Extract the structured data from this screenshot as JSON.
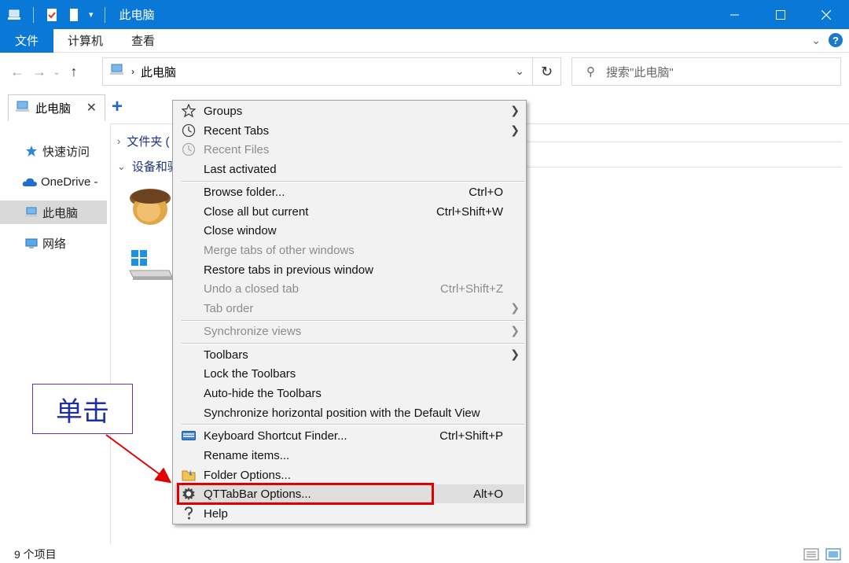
{
  "window": {
    "title": "此电脑"
  },
  "ribbon": {
    "tabs": [
      "文件",
      "计算机",
      "查看"
    ],
    "help": "?"
  },
  "address": {
    "crumb": "此电脑"
  },
  "search": {
    "placeholder": "搜索\"此电脑\""
  },
  "tabbar": {
    "tab_label": "此电脑",
    "close": "✕",
    "add": "+"
  },
  "navpane": {
    "items": [
      "快速访问",
      "OneDrive -",
      "此电脑",
      "网络"
    ]
  },
  "content": {
    "groups": [
      "文件夹 (",
      "设备和驱"
    ]
  },
  "status": {
    "count": "9 个项目"
  },
  "menu": {
    "items": [
      {
        "label": "Groups",
        "shortcut": "",
        "icon": "star-icon",
        "disabled": false,
        "submenu": true
      },
      {
        "label": "Recent Tabs",
        "shortcut": "",
        "icon": "clock-icon",
        "disabled": false,
        "submenu": true
      },
      {
        "label": "Recent Files",
        "shortcut": "",
        "icon": "clock-icon",
        "disabled": true,
        "submenu": false
      },
      {
        "label": "Last activated",
        "shortcut": "",
        "icon": "",
        "disabled": false,
        "submenu": false
      },
      {
        "label": "Browse folder...",
        "shortcut": "Ctrl+O",
        "icon": "",
        "disabled": false,
        "submenu": false
      },
      {
        "label": "Close all but current",
        "shortcut": "Ctrl+Shift+W",
        "icon": "",
        "disabled": false,
        "submenu": false
      },
      {
        "label": "Close window",
        "shortcut": "",
        "icon": "",
        "disabled": false,
        "submenu": false
      },
      {
        "label": "Merge tabs of other windows",
        "shortcut": "",
        "icon": "",
        "disabled": true,
        "submenu": false
      },
      {
        "label": "Restore tabs in previous window",
        "shortcut": "",
        "icon": "",
        "disabled": false,
        "submenu": false
      },
      {
        "label": "Undo a closed tab",
        "shortcut": "Ctrl+Shift+Z",
        "icon": "",
        "disabled": true,
        "submenu": false
      },
      {
        "label": "Tab order",
        "shortcut": "",
        "icon": "",
        "disabled": true,
        "submenu": true
      },
      {
        "label": "Synchronize views",
        "shortcut": "",
        "icon": "",
        "disabled": true,
        "submenu": true
      },
      {
        "label": "Toolbars",
        "shortcut": "",
        "icon": "",
        "disabled": false,
        "submenu": true
      },
      {
        "label": "Lock the Toolbars",
        "shortcut": "",
        "icon": "",
        "disabled": false,
        "submenu": false
      },
      {
        "label": "Auto-hide the Toolbars",
        "shortcut": "",
        "icon": "",
        "disabled": false,
        "submenu": false
      },
      {
        "label": "Synchronize horizontal position with the Default View",
        "shortcut": "",
        "icon": "",
        "disabled": false,
        "submenu": false
      },
      {
        "label": "Keyboard Shortcut Finder...",
        "shortcut": "Ctrl+Shift+P",
        "icon": "keyboard-icon",
        "disabled": false,
        "submenu": false
      },
      {
        "label": "Rename items...",
        "shortcut": "",
        "icon": "",
        "disabled": false,
        "submenu": false
      },
      {
        "label": "Folder Options...",
        "shortcut": "",
        "icon": "folder-options-icon",
        "disabled": false,
        "submenu": false
      },
      {
        "label": "QTTabBar Options...",
        "shortcut": "Alt+O",
        "icon": "gear-icon",
        "disabled": false,
        "submenu": false,
        "highlighted": true
      },
      {
        "label": "Help",
        "shortcut": "",
        "icon": "help-icon",
        "disabled": false,
        "submenu": false
      }
    ]
  },
  "annotation": {
    "text": "单击"
  },
  "colors": {
    "titlebar": "#0a78d7",
    "highlight_border": "#e00000",
    "annotation_border": "#7030a0",
    "annotation_text": "#1f2ea0"
  }
}
